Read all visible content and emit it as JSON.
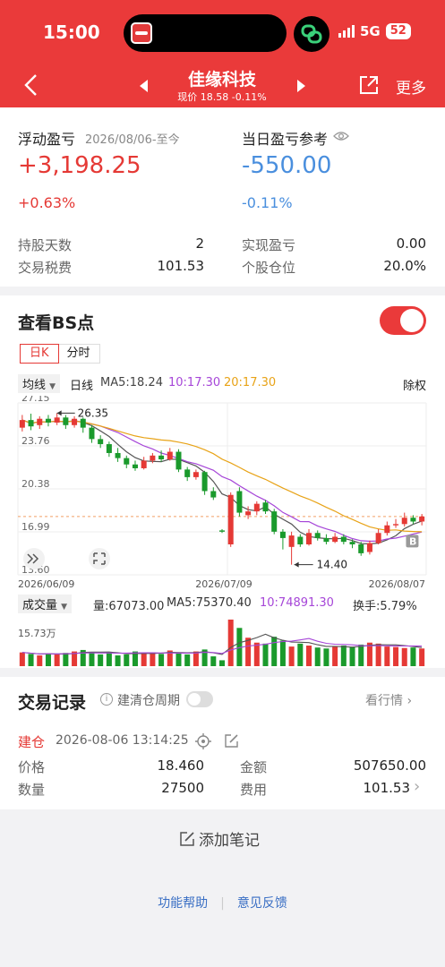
{
  "status_bar": {
    "time": "15:00",
    "network": "5G",
    "battery": "52"
  },
  "header": {
    "stock_name": "佳缘科技",
    "price_line": "现价 18.58 -0.11%",
    "more_label": "更多"
  },
  "summary": {
    "floating_label": "浮动盈亏",
    "floating_date": "2026/08/06-至今",
    "floating_value": "+3,198.25",
    "floating_pct": "+0.63%",
    "today_label": "当日盈亏参考",
    "today_value": "-550.00",
    "today_pct": "-0.11%",
    "hold_days_label": "持股天数",
    "hold_days_value": "2",
    "tax_label": "交易税费",
    "tax_value": "101.53",
    "realized_label": "实现盈亏",
    "realized_value": "0.00",
    "position_label": "个股仓位",
    "position_value": "20.0%"
  },
  "bs": {
    "title": "查看BS点",
    "tab_day": "日K",
    "tab_time": "分时",
    "ma_select": "均线",
    "line_type": "日线",
    "ma5": "MA5:18.24",
    "ma10": "10:17.30",
    "ma20": "20:17.30",
    "adjust": "除权",
    "vol_select": "成交量",
    "vol_text": "量:67073.00",
    "vol_ma5": "MA5:75370.40",
    "vol_ma10": "10:74891.30",
    "turnover": "换手:5.79%",
    "colors": {
      "up": "#e53935",
      "down": "#1a9a2c",
      "ma5": "#555555",
      "ma10": "#a646d8",
      "ma20": "#e8a317"
    }
  },
  "chart_data": {
    "type": "candlestick",
    "price_axis_labels": [
      "27.15",
      "23.76",
      "20.38",
      "16.99",
      "13.60"
    ],
    "ylim": [
      13.6,
      27.15
    ],
    "date_labels": [
      "2026/06/09",
      "2026/07/09",
      "2026/08/07"
    ],
    "max_annotation": "26.35",
    "min_annotation": "14.40",
    "b_marker": "B",
    "volume_axis_label": "15.73万",
    "candles": [
      {
        "o": 25.2,
        "c": 25.8,
        "h": 26.2,
        "l": 24.9
      },
      {
        "o": 25.8,
        "c": 25.3,
        "h": 26.3,
        "l": 25.0
      },
      {
        "o": 25.4,
        "c": 25.9,
        "h": 26.1,
        "l": 25.1
      },
      {
        "o": 25.9,
        "c": 25.6,
        "h": 26.2,
        "l": 25.3
      },
      {
        "o": 25.6,
        "c": 26.0,
        "h": 26.35,
        "l": 25.4
      },
      {
        "o": 26.0,
        "c": 25.4,
        "h": 26.2,
        "l": 25.1
      },
      {
        "o": 25.4,
        "c": 25.9,
        "h": 26.1,
        "l": 25.2
      },
      {
        "o": 25.9,
        "c": 25.2,
        "h": 26.0,
        "l": 24.8
      },
      {
        "o": 25.2,
        "c": 24.3,
        "h": 25.4,
        "l": 24.0
      },
      {
        "o": 24.3,
        "c": 23.9,
        "h": 24.6,
        "l": 23.6
      },
      {
        "o": 23.9,
        "c": 23.2,
        "h": 24.1,
        "l": 22.9
      },
      {
        "o": 23.2,
        "c": 22.8,
        "h": 23.6,
        "l": 22.5
      },
      {
        "o": 22.8,
        "c": 22.3,
        "h": 23.0,
        "l": 22.0
      },
      {
        "o": 22.3,
        "c": 22.0,
        "h": 22.6,
        "l": 21.8
      },
      {
        "o": 22.0,
        "c": 22.6,
        "h": 22.9,
        "l": 21.9
      },
      {
        "o": 22.6,
        "c": 23.0,
        "h": 23.2,
        "l": 22.4
      },
      {
        "o": 23.0,
        "c": 22.7,
        "h": 23.4,
        "l": 22.5
      },
      {
        "o": 22.7,
        "c": 23.3,
        "h": 23.6,
        "l": 22.6
      },
      {
        "o": 23.3,
        "c": 21.9,
        "h": 23.5,
        "l": 21.7
      },
      {
        "o": 21.9,
        "c": 21.3,
        "h": 22.1,
        "l": 21.0
      },
      {
        "o": 21.3,
        "c": 21.7,
        "h": 21.9,
        "l": 21.1
      },
      {
        "o": 21.7,
        "c": 20.2,
        "h": 21.8,
        "l": 19.9
      },
      {
        "o": 20.2,
        "c": 19.7,
        "h": 20.5,
        "l": 19.5
      },
      {
        "o": 17.1,
        "c": 17.0,
        "h": 17.2,
        "l": 16.9
      },
      {
        "o": 16.0,
        "c": 19.9,
        "h": 20.1,
        "l": 15.8
      },
      {
        "o": 20.2,
        "c": 18.5,
        "h": 20.5,
        "l": 18.2
      },
      {
        "o": 18.3,
        "c": 18.6,
        "h": 19.0,
        "l": 18.0
      },
      {
        "o": 18.6,
        "c": 19.2,
        "h": 19.4,
        "l": 18.3
      },
      {
        "o": 19.3,
        "c": 18.6,
        "h": 19.5,
        "l": 18.4
      },
      {
        "o": 18.6,
        "c": 17.0,
        "h": 18.8,
        "l": 16.8
      },
      {
        "o": 17.0,
        "c": 16.5,
        "h": 17.2,
        "l": 15.6
      },
      {
        "o": 15.8,
        "c": 16.7,
        "h": 17.0,
        "l": 14.4
      },
      {
        "o": 16.6,
        "c": 16.0,
        "h": 16.8,
        "l": 15.8
      },
      {
        "o": 16.0,
        "c": 16.9,
        "h": 17.2,
        "l": 15.9
      },
      {
        "o": 16.9,
        "c": 16.5,
        "h": 17.1,
        "l": 16.3
      },
      {
        "o": 16.5,
        "c": 16.2,
        "h": 16.8,
        "l": 16.0
      },
      {
        "o": 16.2,
        "c": 16.6,
        "h": 16.9,
        "l": 16.1
      },
      {
        "o": 16.6,
        "c": 16.2,
        "h": 16.8,
        "l": 16.0
      },
      {
        "o": 16.2,
        "c": 16.0,
        "h": 16.4,
        "l": 15.7
      },
      {
        "o": 16.0,
        "c": 15.3,
        "h": 16.2,
        "l": 15.1
      },
      {
        "o": 15.4,
        "c": 16.1,
        "h": 16.3,
        "l": 15.2
      },
      {
        "o": 16.1,
        "c": 16.9,
        "h": 17.2,
        "l": 16.0
      },
      {
        "o": 16.9,
        "c": 17.5,
        "h": 17.8,
        "l": 16.7
      },
      {
        "o": 17.5,
        "c": 17.6,
        "h": 18.0,
        "l": 17.3
      },
      {
        "o": 17.6,
        "c": 18.1,
        "h": 18.5,
        "l": 17.4
      },
      {
        "o": 18.1,
        "c": 17.8,
        "h": 18.3,
        "l": 17.6
      },
      {
        "o": 17.8,
        "c": 18.2,
        "h": 18.4,
        "l": 17.5
      }
    ],
    "volumes": [
      28,
      25,
      22,
      26,
      24,
      27,
      30,
      33,
      29,
      24,
      28,
      22,
      24,
      30,
      26,
      28,
      25,
      32,
      28,
      24,
      30,
      34,
      20,
      12,
      95,
      78,
      58,
      48,
      46,
      60,
      52,
      40,
      46,
      42,
      38,
      36,
      40,
      42,
      39,
      44,
      48,
      46,
      40,
      39,
      37,
      38,
      36
    ]
  },
  "trade": {
    "title": "交易记录",
    "cycle_label": "建清仓周期",
    "view_quote": "看行情",
    "build_label": "建仓",
    "time": "2026-08-06 13:14:25",
    "price_label": "价格",
    "price_value": "18.460",
    "amount_label": "金额",
    "amount_value": "507650.00",
    "qty_label": "数量",
    "qty_value": "27500",
    "fee_label": "费用",
    "fee_value": "101.53"
  },
  "footer": {
    "add_note": "添加笔记",
    "help": "功能帮助",
    "feedback": "意见反馈"
  }
}
